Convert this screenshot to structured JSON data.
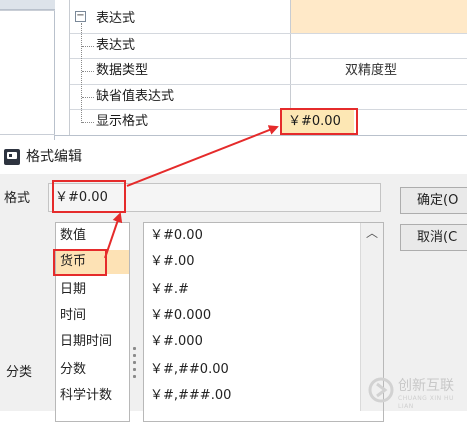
{
  "property_tree": {
    "rows": [
      {
        "label": "表达式",
        "value": ""
      },
      {
        "label": "表达式",
        "value": ""
      },
      {
        "label": "数据类型",
        "value": "双精度型"
      },
      {
        "label": "缺省值表达式",
        "value": ""
      },
      {
        "label": "显示格式",
        "value": "￥#0.00"
      }
    ],
    "collapse_glyph": "−"
  },
  "dialog": {
    "title": "格式编辑",
    "format_label": "格式",
    "format_value": "￥#0.00",
    "ok_label": "确定(O",
    "cancel_label": "取消(C",
    "category_label": "分类",
    "categories": [
      "数值",
      "货币",
      "日期",
      "时间",
      "日期时间",
      "分数",
      "科学计数"
    ],
    "selected_category": "货币",
    "patterns": [
      "￥#0.00",
      "￥#.00",
      "￥#.#",
      "￥#0.000",
      "￥#.000",
      "￥#,##0.00",
      "￥#,###.00"
    ],
    "scroll_up_glyph": "︿"
  },
  "watermark": {
    "text": "创新互联",
    "sub": "CHUANG XIN HU LIAN"
  },
  "colors": {
    "annotation_red": "#e52b2b",
    "highlight_orange": "#fde2b5"
  }
}
